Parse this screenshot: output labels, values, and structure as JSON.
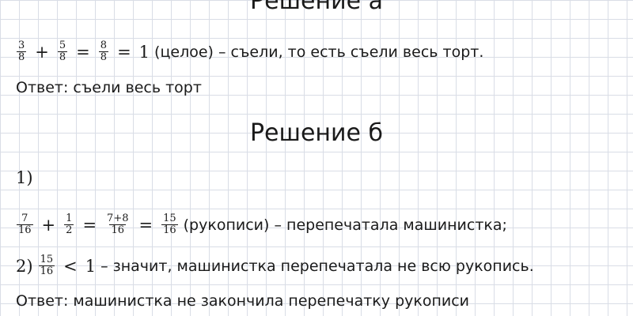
{
  "solution_a": {
    "heading": "Решение а",
    "expr": {
      "f1_num": "3",
      "f1_den": "8",
      "plus": "+",
      "f2_num": "5",
      "f2_den": "8",
      "eq1": "=",
      "f3_num": "8",
      "f3_den": "8",
      "eq2": "=",
      "result": "1"
    },
    "text": "(целое) – съели, то есть съели весь торт.",
    "answer": "Ответ: съели весь торт"
  },
  "solution_b": {
    "heading": "Решение б",
    "step1_label": "1)",
    "expr1": {
      "f1_num": "7",
      "f1_den": "16",
      "plus": "+",
      "f2_num": "1",
      "f2_den": "2",
      "eq1": "=",
      "f3_num": "7+8",
      "f3_den": "16",
      "eq2": "=",
      "f4_num": "15",
      "f4_den": "16"
    },
    "text1": "(рукописи) – перепечатала машинистка;",
    "step2_label": "2)",
    "expr2": {
      "f_num": "15",
      "f_den": "16",
      "lt": "<",
      "one": "1"
    },
    "text2": "– значит, машинистка перепечатала не всю рукопись.",
    "answer": "Ответ: машинистка не закончила перепечатку рукописи"
  }
}
